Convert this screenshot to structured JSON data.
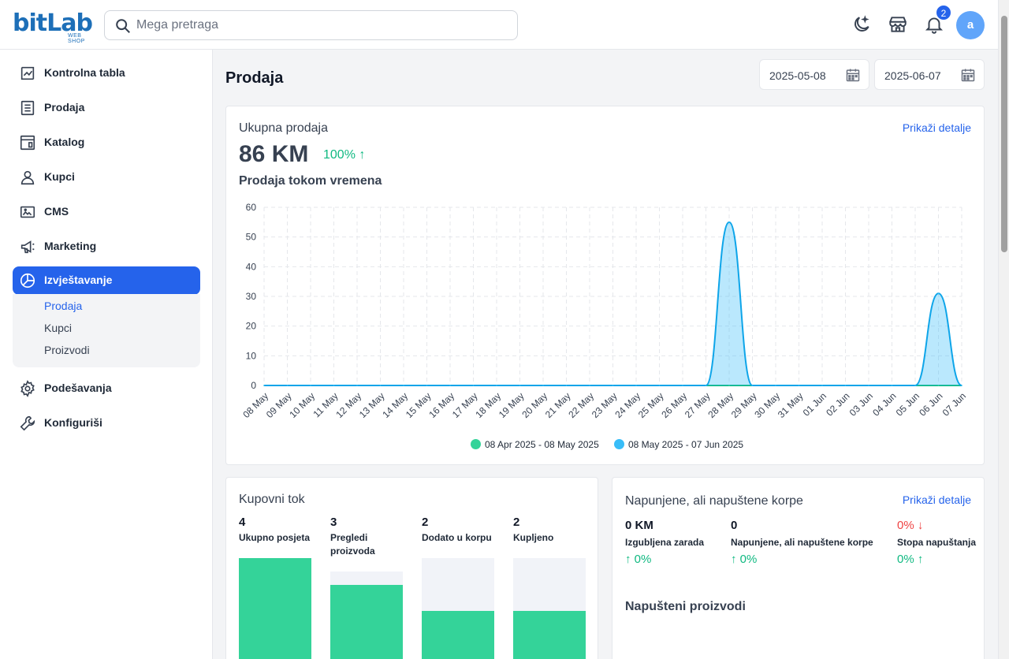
{
  "brand": {
    "logo_text": "bitLab",
    "logo_sub": "WEB SHOP"
  },
  "search": {
    "placeholder": "Mega pretraga"
  },
  "header": {
    "notifications_count": "2",
    "avatar_letter": "a"
  },
  "sidebar": {
    "items": [
      {
        "label": "Kontrolna tabla",
        "icon": "chart-line-icon"
      },
      {
        "label": "Prodaja",
        "icon": "document-icon"
      },
      {
        "label": "Katalog",
        "icon": "catalog-icon"
      },
      {
        "label": "Kupci",
        "icon": "user-icon"
      },
      {
        "label": "CMS",
        "icon": "cms-icon"
      },
      {
        "label": "Marketing",
        "icon": "megaphone-icon"
      },
      {
        "label": "Izvještavanje",
        "icon": "pie-chart-icon",
        "active": true
      },
      {
        "label": "Podešavanja",
        "icon": "gear-icon"
      },
      {
        "label": "Konfiguriši",
        "icon": "wrench-icon"
      }
    ],
    "submenu": [
      "Prodaja",
      "Kupci",
      "Proizvodi"
    ]
  },
  "page": {
    "title": "Prodaja",
    "date_from": "2025-05-08",
    "date_to": "2025-06-07"
  },
  "sales_card": {
    "title": "Ukupna prodaja",
    "details_link": "Prikaži detalje",
    "total": "86 KM",
    "growth": "100% ↑",
    "chart_title": "Prodaja tokom vremena"
  },
  "chart_data": {
    "type": "area",
    "x": [
      "08 May",
      "09 May",
      "10 May",
      "11 May",
      "12 May",
      "13 May",
      "14 May",
      "15 May",
      "16 May",
      "17 May",
      "18 May",
      "19 May",
      "20 May",
      "21 May",
      "22 May",
      "23 May",
      "24 May",
      "25 May",
      "26 May",
      "27 May",
      "28 May",
      "29 May",
      "30 May",
      "31 May",
      "01 Jun",
      "02 Jun",
      "03 Jun",
      "04 Jun",
      "05 Jun",
      "06 Jun",
      "07 Jun"
    ],
    "series": [
      {
        "name": "08 Apr 2025 - 08 May 2025",
        "color": "#34d399",
        "values": [
          0,
          0,
          0,
          0,
          0,
          0,
          0,
          0,
          0,
          0,
          0,
          0,
          0,
          0,
          0,
          0,
          0,
          0,
          0,
          0,
          0,
          0,
          0,
          0,
          0,
          0,
          0,
          0,
          0,
          0,
          0
        ]
      },
      {
        "name": "08 May 2025 - 07 Jun 2025",
        "color": "#38bdf8",
        "values": [
          0,
          0,
          0,
          0,
          0,
          0,
          0,
          0,
          0,
          0,
          0,
          0,
          0,
          0,
          0,
          0,
          0,
          0,
          0,
          0,
          55,
          0,
          0,
          0,
          0,
          0,
          0,
          0,
          0,
          31,
          0
        ]
      }
    ],
    "ylim": [
      0,
      60
    ],
    "yticks": [
      0,
      10,
      20,
      30,
      40,
      50,
      60
    ],
    "grid": true,
    "legend_position": "bottom"
  },
  "funnel": {
    "title": "Kupovni tok",
    "steps": [
      {
        "value": "4",
        "label": "Ukupno posjeta",
        "ratio": 1.0
      },
      {
        "value": "3",
        "label": "Pregledi proizvoda",
        "ratio": 0.75
      },
      {
        "value": "2",
        "label": "Dodato u korpu",
        "ratio": 0.5
      },
      {
        "value": "2",
        "label": "Kupljeno",
        "ratio": 0.5
      }
    ]
  },
  "abandoned": {
    "title": "Napunjene, ali napuštene korpe",
    "details_link": "Prikaži detalje",
    "stats": [
      {
        "value": "0 KM",
        "label": "Izgubljena zarada",
        "trend": "↑ 0%",
        "value_color": "#111827"
      },
      {
        "value": "0",
        "label": "Napunjene, ali napuštene korpe",
        "trend": "↑ 0%",
        "value_color": "#111827"
      },
      {
        "value": "0% ↓",
        "label": "Stopa napuštanja",
        "trend": "0% ↑",
        "value_color": "#ef4444"
      }
    ],
    "products_title": "Napušteni proizvodi"
  }
}
